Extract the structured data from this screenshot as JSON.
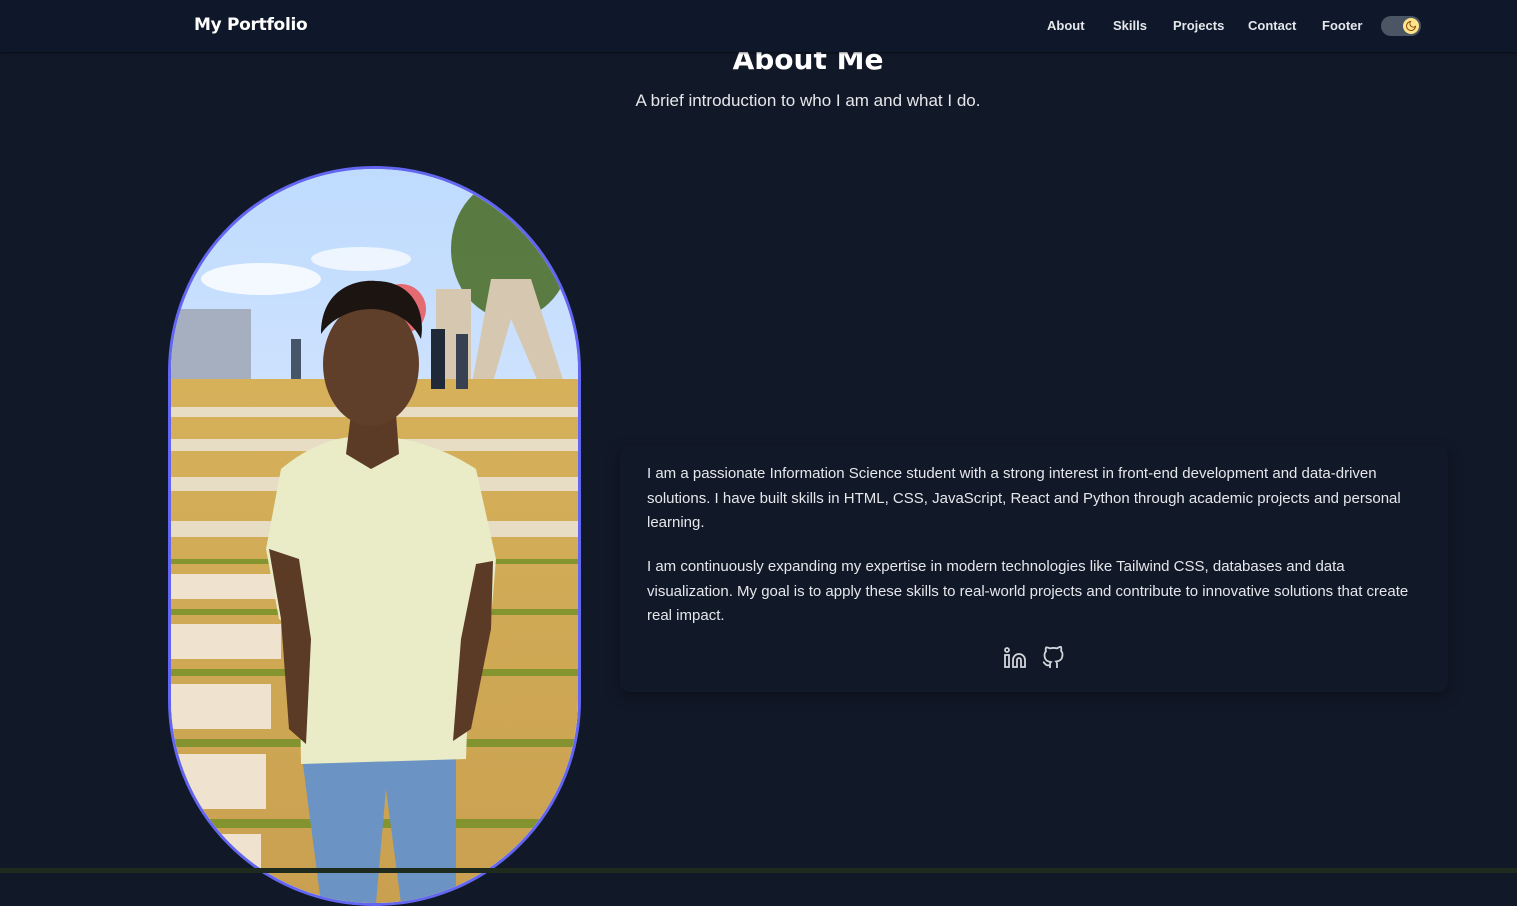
{
  "navbar": {
    "brand": "My Portfolio",
    "links": [
      "About",
      "Skills",
      "Projects",
      "Contact",
      "Footer"
    ],
    "theme_toggle": "moon-icon"
  },
  "about": {
    "title": "About Me",
    "subtitle": "A brief introduction to who I am and what I do.",
    "paragraph1": "I am a passionate Information Science student with a strong interest in front-end development and data-driven solutions. I have built skills in HTML, CSS, JavaScript, React and Python through academic projects and personal learning.",
    "paragraph2": "I am continuously expanding my expertise in modern technologies like Tailwind CSS, databases and data visualization. My goal is to apply these skills to real-world projects and contribute to innovative solutions that create real impact.",
    "social_icons": [
      "linkedin-icon",
      "github-icon"
    ]
  },
  "colors": {
    "background": "#111827",
    "navbar": "#0f172a",
    "accent": "#6366f1",
    "toggle_knob": "#fde68a"
  }
}
